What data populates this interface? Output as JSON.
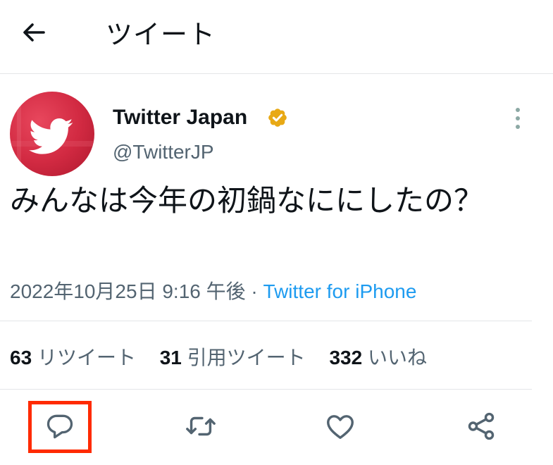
{
  "header": {
    "title": "ツイート",
    "back_icon": "arrow-left-icon"
  },
  "tweet": {
    "author": {
      "display_name": "Twitter Japan",
      "handle": "@TwitterJP",
      "verified": true,
      "verified_color": "#e8a915",
      "avatar_color": "#d22a42"
    },
    "text": "みんなは今年の初鍋なににしたの？",
    "date": "2022年10月25日 9:16 午後",
    "separator": "·",
    "source": "Twitter for iPhone",
    "source_color": "#1d9bf0",
    "stats": {
      "retweets": "63",
      "retweets_label": "リツイート",
      "quotes": "31",
      "quotes_label": "引用ツイート",
      "likes": "332",
      "likes_label": "いいね"
    },
    "actions": [
      "reply-icon",
      "retweet-icon",
      "like-icon",
      "share-icon"
    ],
    "highlight_color": "#ff2a00"
  }
}
